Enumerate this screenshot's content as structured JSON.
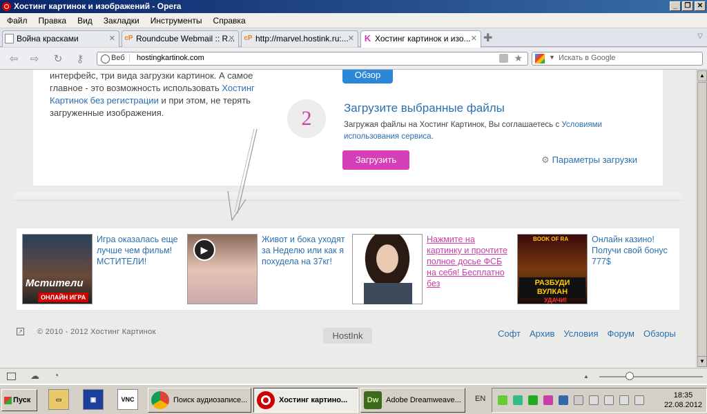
{
  "window": {
    "title": "Хостинг картинок и изображений - Opera",
    "btn_min": "_",
    "btn_max": "❐",
    "btn_close": "✕"
  },
  "menu": [
    "Файл",
    "Правка",
    "Вид",
    "Закладки",
    "Инструменты",
    "Справка"
  ],
  "tabs": [
    {
      "label": "Война красками",
      "icon": "page-icon"
    },
    {
      "label": "Roundcube Webmail :: R...",
      "icon": "cpanel-icon",
      "icon_text": "cP"
    },
    {
      "label": "http://marvel.hostink.ru:...",
      "icon": "cpanel-icon",
      "icon_text": "cP"
    },
    {
      "label": "Хостинг картинок и изо...",
      "icon": "hostink-icon",
      "icon_text": "K"
    }
  ],
  "address": {
    "web_label": "Веб",
    "url": "hostingkartinok.com",
    "search_placeholder": "Искать в Google"
  },
  "page": {
    "left_text_1": "интерфейс, три вида загрузки картинок. А самое главное - это возможность использовать ",
    "left_link": "Хостинг Картинок без регистрации",
    "left_text_2": " и при этом, не терять загруженные изображения.",
    "browse_button": "Обзор",
    "step_number": "2",
    "step_title": "Загрузите выбранные файлы",
    "step_desc": "Загружая файлы на Хостинг Картинок, Вы соглашаетесь с ",
    "step_link": "Условиями использования сервиса",
    "step_desc_end": ".",
    "upload_button": "Загрузить",
    "upload_params": "Параметры загрузки"
  },
  "ads": [
    {
      "text": "Игра оказалась еще лучше чем фильм! МСТИТЕЛИ!",
      "img_caption": "Мстители",
      "img_badge": "ОНЛАЙН ИГРА"
    },
    {
      "text": "Живот и бока уходят за Неделю или как я похудела на 37кг!"
    },
    {
      "text": "Нажмите на картинку и прочтите полное досье ФСБ на себя! Бесплатно без"
    },
    {
      "text": "Онлайн казино! Получи свой бонус 777$",
      "img_caption": "РАЗБУДИ ВУЛКАН",
      "img_badge": "УДАЧИ!",
      "img_top": "BOOK OF RA"
    }
  ],
  "footer": {
    "copyright": "© 2010 - 2012 Хостинг Картинок",
    "brand": "HostInk",
    "links": [
      "Софт",
      "Архив",
      "Условия",
      "Форум",
      "Обзоры"
    ]
  },
  "taskbar": {
    "start": "Пуск",
    "tasks": [
      {
        "label": "Поиск аудиозаписе...",
        "icon_color": "#4a8f3a"
      },
      {
        "label": "Хостинг картино...",
        "icon_color": "#cc0000",
        "active": true
      },
      {
        "label": "Adobe Dreamweave...",
        "icon_color": "#3d6b1e",
        "icon_text": "Dw"
      }
    ],
    "lang": "EN",
    "time": "18:35",
    "date": "22.08.2012",
    "quick_vnc": "VNC"
  },
  "colors": {
    "accent_blue": "#2b88d9",
    "accent_pink": "#d63fb8",
    "link": "#2a6fb0"
  }
}
